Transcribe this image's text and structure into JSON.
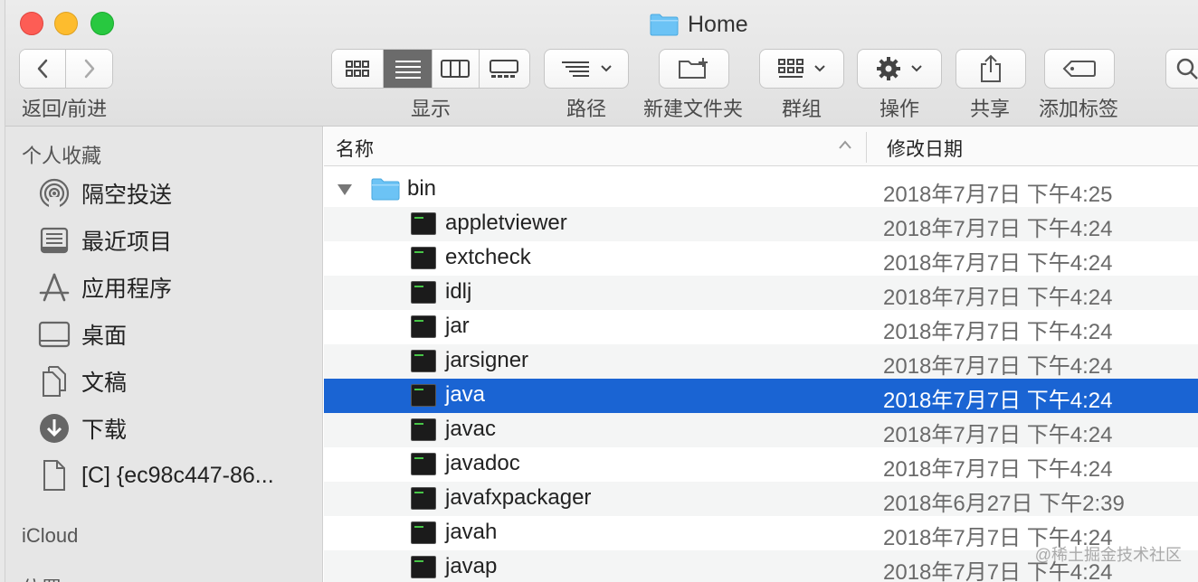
{
  "window": {
    "title": "Home"
  },
  "toolbar": {
    "back_forward_label": "返回/前进",
    "view_label": "显示",
    "path_label": "路径",
    "new_folder_label": "新建文件夹",
    "group_label": "群组",
    "action_label": "操作",
    "share_label": "共享",
    "tags_label": "添加标签"
  },
  "sidebar": {
    "favorites_title": "个人收藏",
    "items": [
      {
        "label": "隔空投送",
        "icon": "airdrop-icon"
      },
      {
        "label": "最近项目",
        "icon": "recents-icon"
      },
      {
        "label": "应用程序",
        "icon": "applications-icon"
      },
      {
        "label": "桌面",
        "icon": "desktop-icon"
      },
      {
        "label": "文稿",
        "icon": "documents-icon"
      },
      {
        "label": "下载",
        "icon": "downloads-icon"
      },
      {
        "label": "[C] {ec98c447-86...",
        "icon": "document-icon"
      }
    ],
    "icloud_title": "iCloud",
    "locations_title": "位置"
  },
  "list": {
    "columns": {
      "name": "名称",
      "modified": "修改日期"
    },
    "folder": {
      "name": "bin",
      "date": "2018年7月7日 下午4:25",
      "expanded": true
    },
    "files": [
      {
        "name": "appletviewer",
        "date": "2018年7月7日 下午4:24"
      },
      {
        "name": "extcheck",
        "date": "2018年7月7日 下午4:24"
      },
      {
        "name": "idlj",
        "date": "2018年7月7日 下午4:24"
      },
      {
        "name": "jar",
        "date": "2018年7月7日 下午4:24"
      },
      {
        "name": "jarsigner",
        "date": "2018年7月7日 下午4:24"
      },
      {
        "name": "java",
        "date": "2018年7月7日 下午4:24",
        "selected": true
      },
      {
        "name": "javac",
        "date": "2018年7月7日 下午4:24"
      },
      {
        "name": "javadoc",
        "date": "2018年7月7日 下午4:24"
      },
      {
        "name": "javafxpackager",
        "date": "2018年6月27日 下午2:39"
      },
      {
        "name": "javah",
        "date": "2018年7月7日 下午4:24"
      },
      {
        "name": "javap",
        "date": "2018年7月7日 下午4:24"
      }
    ]
  },
  "watermark": "@稀土掘金技术社区",
  "colors": {
    "selection": "#1a64d3",
    "folder": "#6cc3f5"
  }
}
